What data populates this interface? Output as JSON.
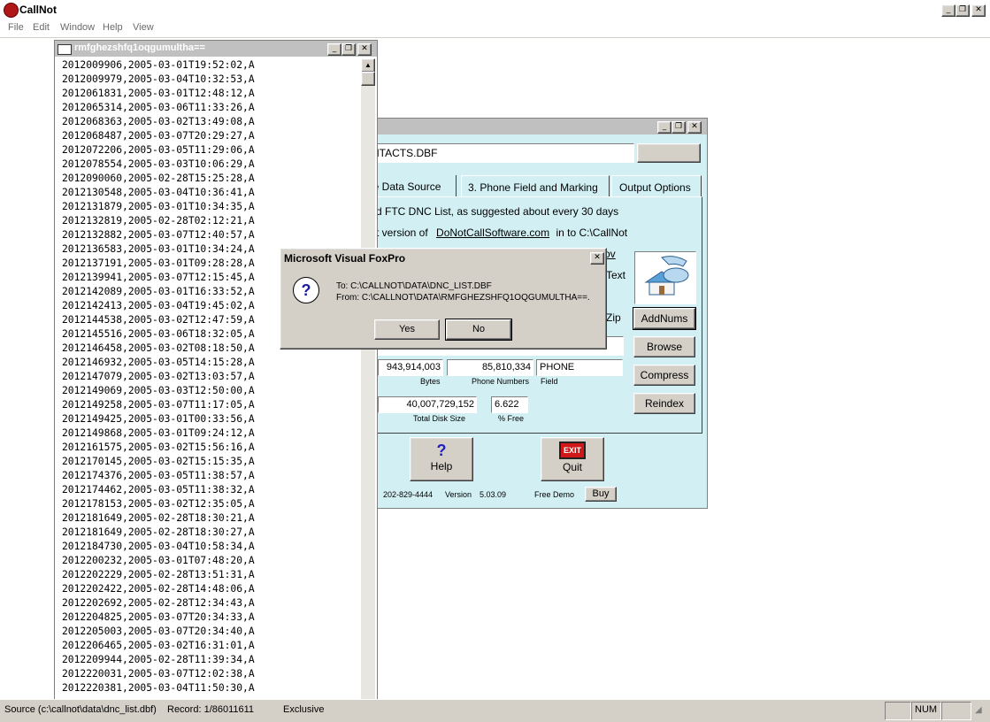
{
  "app": {
    "title": "CallNot",
    "menu": [
      "File",
      "Edit",
      "Window",
      "Help",
      "View"
    ]
  },
  "browse": {
    "title": "rmfghezshfq1oqgumultha==",
    "rows": [
      "2012009906,2005-03-01T19:52:02,A",
      "2012009979,2005-03-04T10:32:53,A",
      "2012061831,2005-03-01T12:48:12,A",
      "2012065314,2005-03-06T11:33:26,A",
      "2012068363,2005-03-02T13:49:08,A",
      "2012068487,2005-03-07T20:29:27,A",
      "2012072206,2005-03-05T11:29:06,A",
      "2012078554,2005-03-03T10:06:29,A",
      "2012090060,2005-02-28T15:25:28,A",
      "2012130548,2005-03-04T10:36:41,A",
      "2012131879,2005-03-01T10:34:35,A",
      "2012132819,2005-02-28T02:12:21,A",
      "2012132882,2005-03-07T12:40:57,A",
      "2012136583,2005-03-01T10:34:24,A",
      "2012137191,2005-03-01T09:28:28,A",
      "2012139941,2005-03-07T12:15:45,A",
      "2012142089,2005-03-01T16:33:52,A",
      "2012142413,2005-03-04T19:45:02,A",
      "2012144538,2005-03-02T12:47:59,A",
      "2012145516,2005-03-06T18:32:05,A",
      "2012146458,2005-03-02T08:18:50,A",
      "2012146932,2005-03-05T14:15:28,A",
      "2012147079,2005-03-02T13:03:57,A",
      "2012149069,2005-03-03T12:50:00,A",
      "2012149258,2005-03-07T11:17:05,A",
      "2012149425,2005-03-01T00:33:56,A",
      "2012149868,2005-03-01T09:24:12,A",
      "2012161575,2005-03-02T15:56:16,A",
      "2012170145,2005-03-02T15:15:35,A",
      "2012174376,2005-03-05T11:38:57,A",
      "2012174462,2005-03-05T11:38:32,A",
      "2012178153,2005-03-02T12:35:05,A",
      "2012181649,2005-02-28T18:30:21,A",
      "2012181649,2005-02-28T18:30:27,A",
      "2012184730,2005-03-04T10:58:34,A",
      "2012200232,2005-03-01T07:48:20,A",
      "2012202229,2005-02-28T13:51:31,A",
      "2012202422,2005-02-28T14:48:06,A",
      "2012202692,2005-02-28T12:34:43,A",
      "2012204825,2005-03-07T20:34:33,A",
      "2012205003,2005-03-07T20:34:40,A",
      "2012206465,2005-03-02T16:31:01,A",
      "2012209944,2005-02-28T11:39:34,A",
      "2012220031,2005-03-07T12:02:38,A",
      "2012220381,2005-03-04T11:50:30,A"
    ]
  },
  "panel": {
    "file_field": "NTACTS.DBF",
    "tabs": [
      "ne Data Source",
      "3. Phone Field and Marking",
      "Output Options"
    ],
    "line1": "d FTC DNC List, as suggested about every 30 days",
    "line2_pre": "t version of",
    "line2_link": "DoNotCallSoftware.com",
    "line2_post": "in to C:\\CallNot",
    "frag_ov": "ov",
    "frag_text": "Text",
    "frag_zip": "Zip",
    "buttons": {
      "addnums": "AddNums",
      "browse": "Browse",
      "compress": "Compress",
      "reindex": "Reindex"
    },
    "stats": {
      "bytes_value": "943,914,003",
      "bytes_label": "Bytes",
      "phones_value": "85,810,334",
      "phones_label": "Phone Numbers",
      "field_value": "PHONE",
      "field_label": "Field",
      "disk_value": "40,007,729,152",
      "disk_label": "Total Disk Size",
      "free_value": "6.622",
      "free_label": "% Free"
    },
    "help_label": "Help",
    "quit_label": "Quit",
    "exit_sign": "EXIT",
    "phone": "202-829-4444",
    "version_label": "Version",
    "version_value": "5.03.09",
    "demo_label": "Free Demo",
    "buy_label": "Buy"
  },
  "dialog": {
    "title": "Microsoft Visual FoxPro",
    "line1": "To: C:\\CALLNOT\\DATA\\DNC_LIST.DBF",
    "line2": "From: C:\\CALLNOT\\DATA\\RMFGHEZSHFQ1OQGUMULTHA==.",
    "yes": "Yes",
    "no": "No"
  },
  "status": {
    "source": "Source (c:\\callnot\\data\\dnc_list.dbf)",
    "record": "Record: 1/86011611",
    "mode": "Exclusive",
    "num": "NUM"
  },
  "colors": {
    "panel_bg": "#d2f0f4",
    "face": "#d4d0c8",
    "exit_red": "#d01818"
  }
}
